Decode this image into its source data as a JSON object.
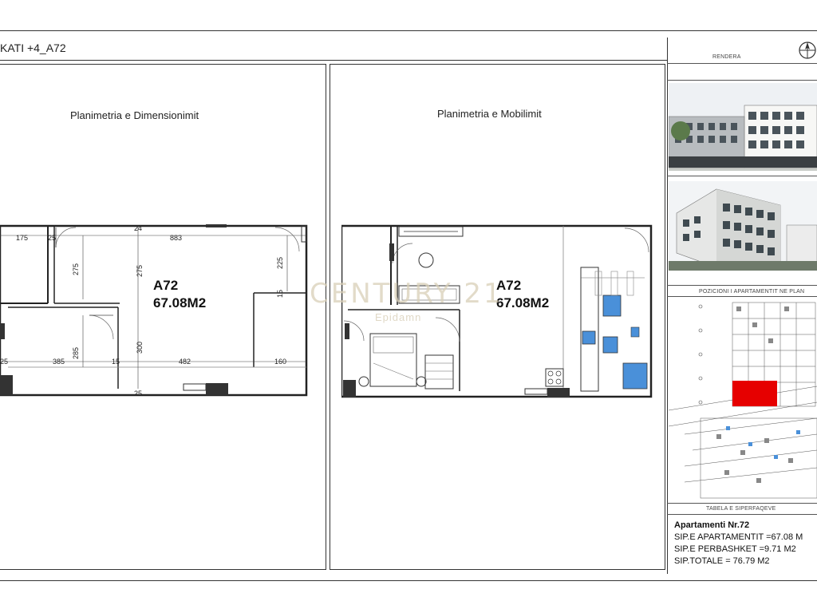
{
  "sheet": {
    "title": "KATI +4_A72"
  },
  "panels": {
    "dimension": {
      "title": "Planimetria e Dimensionimit",
      "apt_code": "A72",
      "apt_area": "67.08M2",
      "dims": {
        "d175": "175",
        "d25a": "25",
        "d883": "883",
        "d24": "24",
        "d275a": "275",
        "d275b": "275",
        "d225": "225",
        "d15a": "15",
        "d285": "285",
        "d300": "300",
        "d25b": "25",
        "d385": "385",
        "d15b": "15",
        "d482": "482",
        "d160": "160",
        "d25c": "25"
      }
    },
    "furniture": {
      "title": "Planimetria e Mobilimit",
      "apt_code": "A72",
      "apt_area": "67.08M2"
    }
  },
  "watermark": {
    "brand": "CENTURY 21",
    "sub": "Epidamn"
  },
  "sidebar": {
    "render_label": "RENDERA",
    "position_label": "POZICIONI I APARTAMENTIT NE PLAN",
    "table_label": "TABELA E SIPERFAQEVE",
    "apartment_title": "Apartamenti Nr.72",
    "area_apartment": "SIP.E APARTAMENTIT =67.08 M",
    "area_common": "SIP.E PERBASHKET =9.71 M2",
    "area_total": "SIP.TOTALE = 76.79 M2"
  },
  "colors": {
    "highlight": "#e60000",
    "fixture_blue": "#4a90d9",
    "watermark": "#d9cfb8"
  }
}
